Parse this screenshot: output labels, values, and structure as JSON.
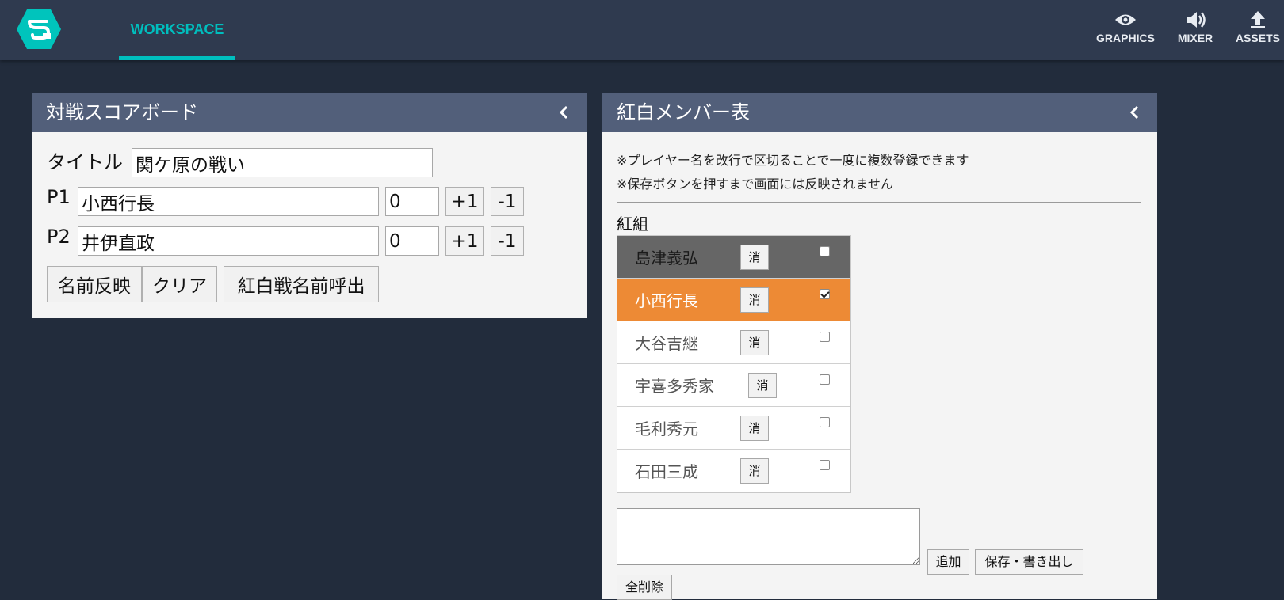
{
  "topbar": {
    "logo_text": "つ",
    "workspace_tab": "WORKSPACE",
    "nav": {
      "graphics": "GRAPHICS",
      "mixer": "MIXER",
      "assets": "ASSETS"
    }
  },
  "colors": {
    "accent": "#00bebe",
    "selected_row": "#ed8a35",
    "header_row": "#666666",
    "panel_header": "#525f7a",
    "background": "#222c3c"
  },
  "scoreboard": {
    "title": "対戦スコアボード",
    "title_label": "タイトル",
    "title_value": "関ケ原の戦い",
    "p1_label": "P1",
    "p1_name": "小西行長",
    "p1_score": "0",
    "p2_label": "P2",
    "p2_name": "井伊直政",
    "p2_score": "0",
    "plus_label": "+1",
    "minus_label": "-1",
    "apply_names": "名前反映",
    "clear": "クリア",
    "recall_names": "紅白戦名前呼出"
  },
  "members": {
    "title": "紅白メンバー表",
    "note1": "※プレイヤー名を改行で区切ることで一度に複数登録できます",
    "note2": "※保存ボタンを押すまで画面には反映されません",
    "group_label": "紅組",
    "delete_label": "消",
    "rows": [
      {
        "name": "島津義弘",
        "checked": false,
        "state": "header"
      },
      {
        "name": "小西行長",
        "checked": true,
        "state": "selected"
      },
      {
        "name": "大谷吉継",
        "checked": false,
        "state": "normal"
      },
      {
        "name": "宇喜多秀家",
        "checked": false,
        "state": "normal"
      },
      {
        "name": "毛利秀元",
        "checked": false,
        "state": "normal"
      },
      {
        "name": "石田三成",
        "checked": false,
        "state": "normal"
      }
    ],
    "add_button": "追加",
    "save_button": "保存・書き出し",
    "delete_all": "全削除"
  },
  "icons": {
    "logo": "logo-icon",
    "graphics": "eye-icon",
    "mixer": "speaker-icon",
    "assets": "upload-icon",
    "collapse": "chevron-left-icon"
  }
}
